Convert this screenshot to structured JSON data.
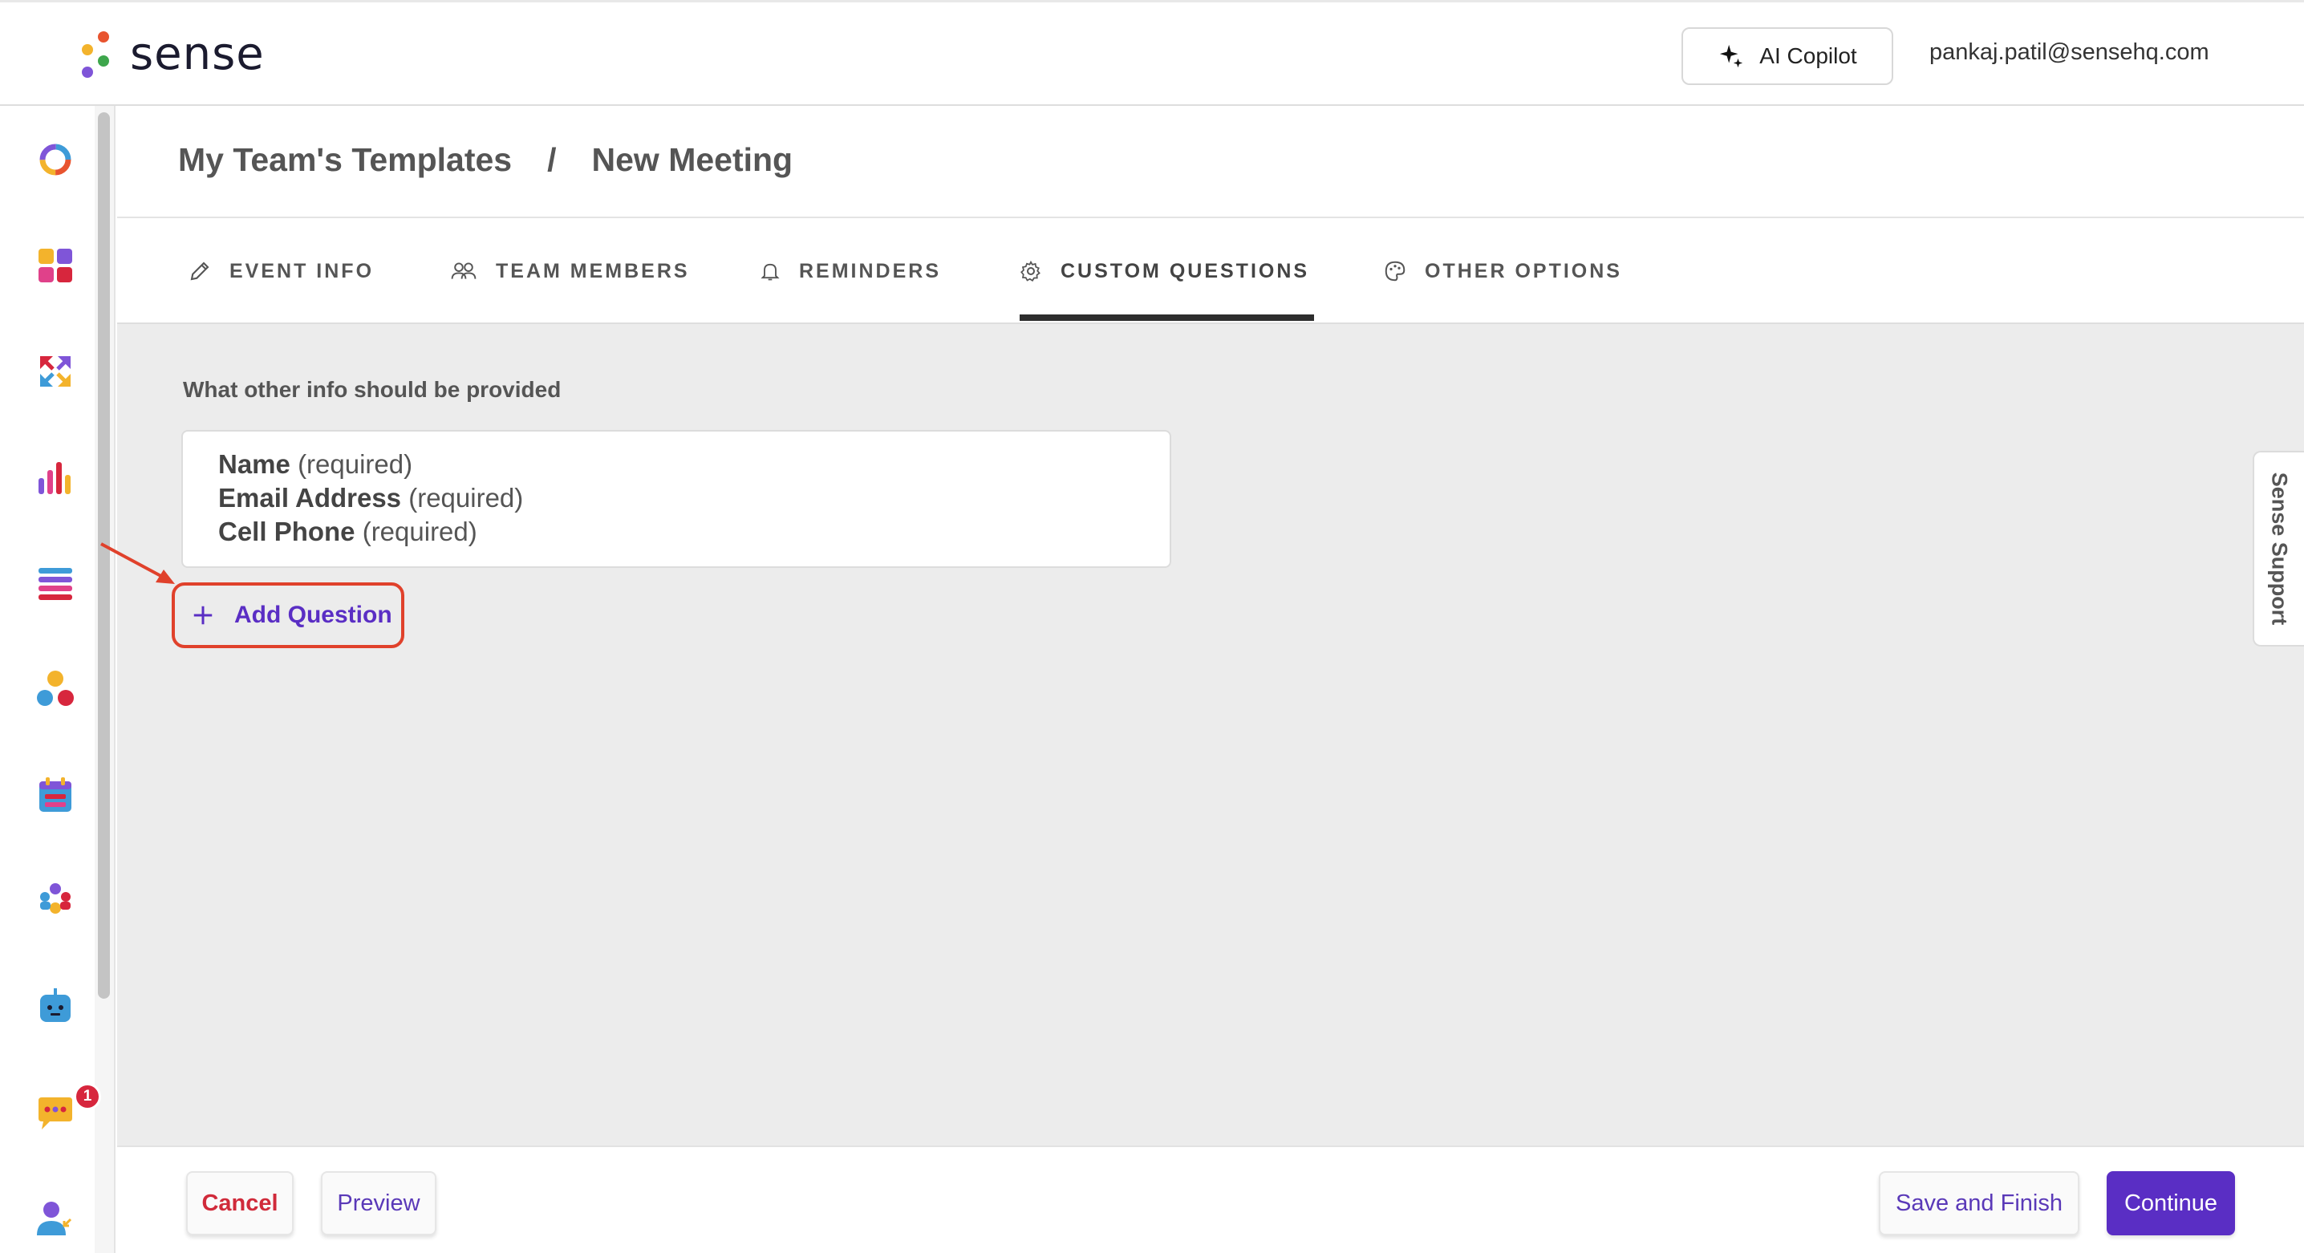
{
  "header": {
    "brand": "sense",
    "copilot_label": "AI Copilot",
    "user_email": "pankaj.patil@sensehq.com"
  },
  "breadcrumb": {
    "parent": "My Team's Templates",
    "separator": "/",
    "current": "New Meeting"
  },
  "tabs": [
    {
      "label": "EVENT INFO",
      "icon": "pencil-icon"
    },
    {
      "label": "TEAM MEMBERS",
      "icon": "people-icon"
    },
    {
      "label": "REMINDERS",
      "icon": "bell-icon"
    },
    {
      "label": "CUSTOM QUESTIONS",
      "icon": "gear-icon",
      "active": true
    },
    {
      "label": "OTHER OPTIONS",
      "icon": "palette-icon"
    }
  ],
  "questions": {
    "section_label": "What other info should be provided",
    "fields": [
      {
        "name": "Name",
        "note": "(required)"
      },
      {
        "name": "Email Address",
        "note": "(required)"
      },
      {
        "name": "Cell Phone",
        "note": "(required)"
      }
    ],
    "add_label": "Add Question"
  },
  "sidebar": {
    "icons": [
      "ring-icon",
      "grid-icon",
      "arrows-icon",
      "bar-chart-icon",
      "list-icon",
      "network-icon",
      "calendar-icon",
      "people-group-icon",
      "bot-icon",
      "chat-icon",
      "user-icon"
    ],
    "chat_badge": "1"
  },
  "support_label": "Sense Support",
  "footer": {
    "cancel": "Cancel",
    "preview": "Preview",
    "save_finish": "Save and Finish",
    "continue": "Continue"
  },
  "colors": {
    "accent": "#5a2ec4",
    "danger": "#d02a3a",
    "highlight": "#e0412b"
  }
}
